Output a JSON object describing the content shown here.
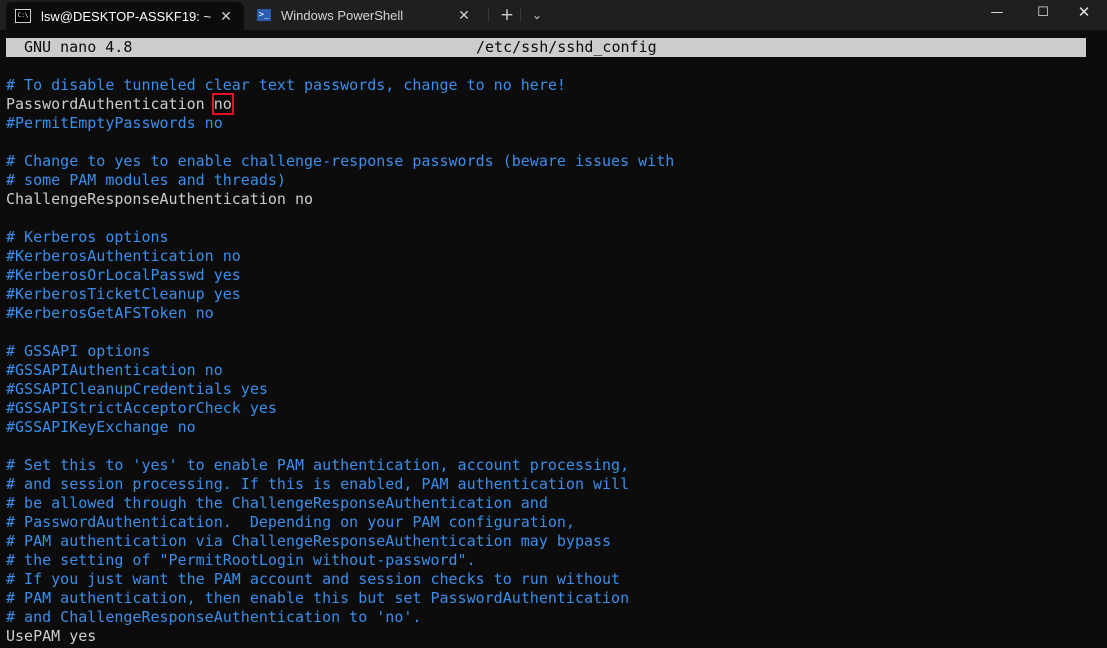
{
  "tabs": [
    {
      "label": "lsw@DESKTOP-ASSKF19: ~",
      "icon": "cmd-terminal-icon",
      "active": true
    },
    {
      "label": "Windows PowerShell",
      "icon": "powershell-icon",
      "active": false
    }
  ],
  "tab_icon_text": {
    "cmd": "C:\\",
    "powershell": ">_"
  },
  "titlebar_glyphs": {
    "new_tab": "+",
    "dropdown": "⌄",
    "close_tab": "✕",
    "minimize": "—",
    "maximize": "☐",
    "close_window": "✕"
  },
  "nano": {
    "version": "GNU nano 4.8",
    "filename": "/etc/ssh/sshd_config"
  },
  "lines": [
    {
      "text": "# To disable tunneled clear text passwords, change to no here!",
      "type": "comment"
    },
    {
      "text": "PasswordAuthentication ",
      "type": "directive",
      "highlight": "no"
    },
    {
      "text": "#PermitEmptyPasswords no",
      "type": "comment"
    },
    {
      "text": "",
      "type": "blank"
    },
    {
      "text": "# Change to yes to enable challenge-response passwords (beware issues with",
      "type": "comment"
    },
    {
      "text": "# some PAM modules and threads)",
      "type": "comment"
    },
    {
      "text": "ChallengeResponseAuthentication no",
      "type": "directive"
    },
    {
      "text": "",
      "type": "blank"
    },
    {
      "text": "# Kerberos options",
      "type": "comment"
    },
    {
      "text": "#KerberosAuthentication no",
      "type": "comment"
    },
    {
      "text": "#KerberosOrLocalPasswd yes",
      "type": "comment"
    },
    {
      "text": "#KerberosTicketCleanup yes",
      "type": "comment"
    },
    {
      "text": "#KerberosGetAFSToken no",
      "type": "comment"
    },
    {
      "text": "",
      "type": "blank"
    },
    {
      "text": "# GSSAPI options",
      "type": "comment"
    },
    {
      "text": "#GSSAPIAuthentication no",
      "type": "comment"
    },
    {
      "text": "#GSSAPICleanupCredentials yes",
      "type": "comment"
    },
    {
      "text": "#GSSAPIStrictAcceptorCheck yes",
      "type": "comment"
    },
    {
      "text": "#GSSAPIKeyExchange no",
      "type": "comment"
    },
    {
      "text": "",
      "type": "blank"
    },
    {
      "text": "# Set this to 'yes' to enable PAM authentication, account processing,",
      "type": "comment"
    },
    {
      "text": "# and session processing. If this is enabled, PAM authentication will",
      "type": "comment"
    },
    {
      "text": "# be allowed through the ChallengeResponseAuthentication and",
      "type": "comment"
    },
    {
      "text": "# PasswordAuthentication.  Depending on your PAM configuration,",
      "type": "comment"
    },
    {
      "text": "# PAM authentication via ChallengeResponseAuthentication may bypass",
      "type": "comment"
    },
    {
      "text": "# the setting of \"PermitRootLogin without-password\".",
      "type": "comment"
    },
    {
      "text": "# If you just want the PAM account and session checks to run without",
      "type": "comment"
    },
    {
      "text": "# PAM authentication, then enable this but set PasswordAuthentication",
      "type": "comment"
    },
    {
      "text": "# and ChallengeResponseAuthentication to 'no'.",
      "type": "comment"
    },
    {
      "text": "UsePAM yes",
      "type": "directive"
    }
  ],
  "colors": {
    "terminal_bg": "#0c0c0c",
    "comment": "#3b8eea",
    "directive": "#cccccc",
    "header_bg": "#cccccc",
    "highlight_box": "#e81123"
  }
}
